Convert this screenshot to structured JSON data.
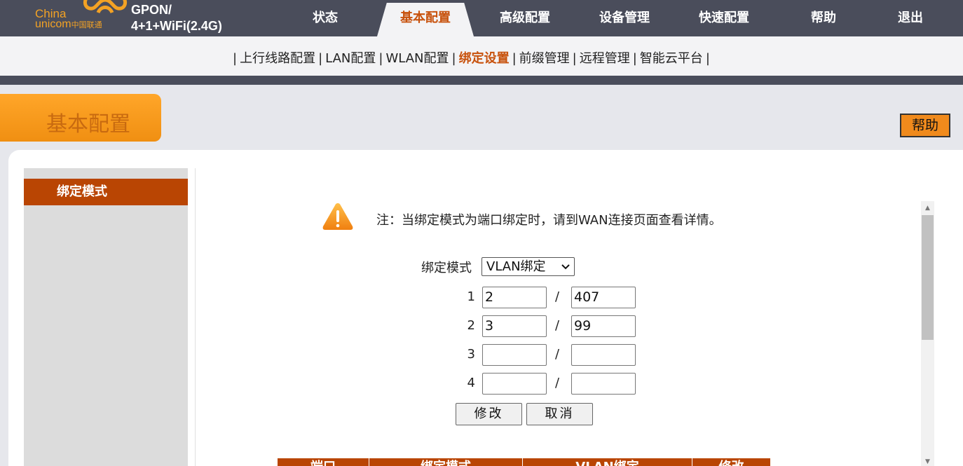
{
  "brand": {
    "logo_line1": "China",
    "logo_line2": "unicom",
    "logo_line3": "中国联通",
    "product_line1": "GPON/",
    "product_line2": "4+1+WiFi(2.4G)",
    "logo_color": "#f3a224"
  },
  "nav": {
    "items": [
      {
        "label": "状态"
      },
      {
        "label": "基本配置"
      },
      {
        "label": "高级配置"
      },
      {
        "label": "设备管理"
      },
      {
        "label": "快速配置"
      },
      {
        "label": "帮助"
      },
      {
        "label": "退出"
      }
    ],
    "active_index": 1
  },
  "subnav": {
    "items": [
      "上行线路配置",
      "LAN配置",
      "WLAN配置",
      "绑定设置",
      "前缀管理",
      "远程管理",
      "智能云平台"
    ],
    "active_index": 3,
    "separator": "|"
  },
  "page": {
    "title": "基本配置",
    "help_label": "帮助"
  },
  "sidebar": {
    "items": [
      {
        "label": "绑定模式",
        "active": true
      }
    ]
  },
  "notice": {
    "icon": "warning-icon",
    "text": "注：当绑定模式为端口绑定时，请到WAN连接页面查看详情。"
  },
  "form": {
    "mode_label": "绑定模式",
    "mode_value": "VLAN绑定",
    "rows": [
      {
        "num": "1",
        "a": "2",
        "b": "407"
      },
      {
        "num": "2",
        "a": "3",
        "b": "99"
      },
      {
        "num": "3",
        "a": "",
        "b": ""
      },
      {
        "num": "4",
        "a": "",
        "b": ""
      }
    ],
    "slash": "/",
    "modify_label": "修改",
    "cancel_label": "取消"
  },
  "table": {
    "headers": [
      "端口",
      "绑定模式",
      "VLAN绑定",
      "修改"
    ]
  },
  "colors": {
    "accent": "#c8520d",
    "nav_bg": "#4a4d5b",
    "sidebar_active": "#b94503",
    "title_orange": "#f08f12"
  }
}
